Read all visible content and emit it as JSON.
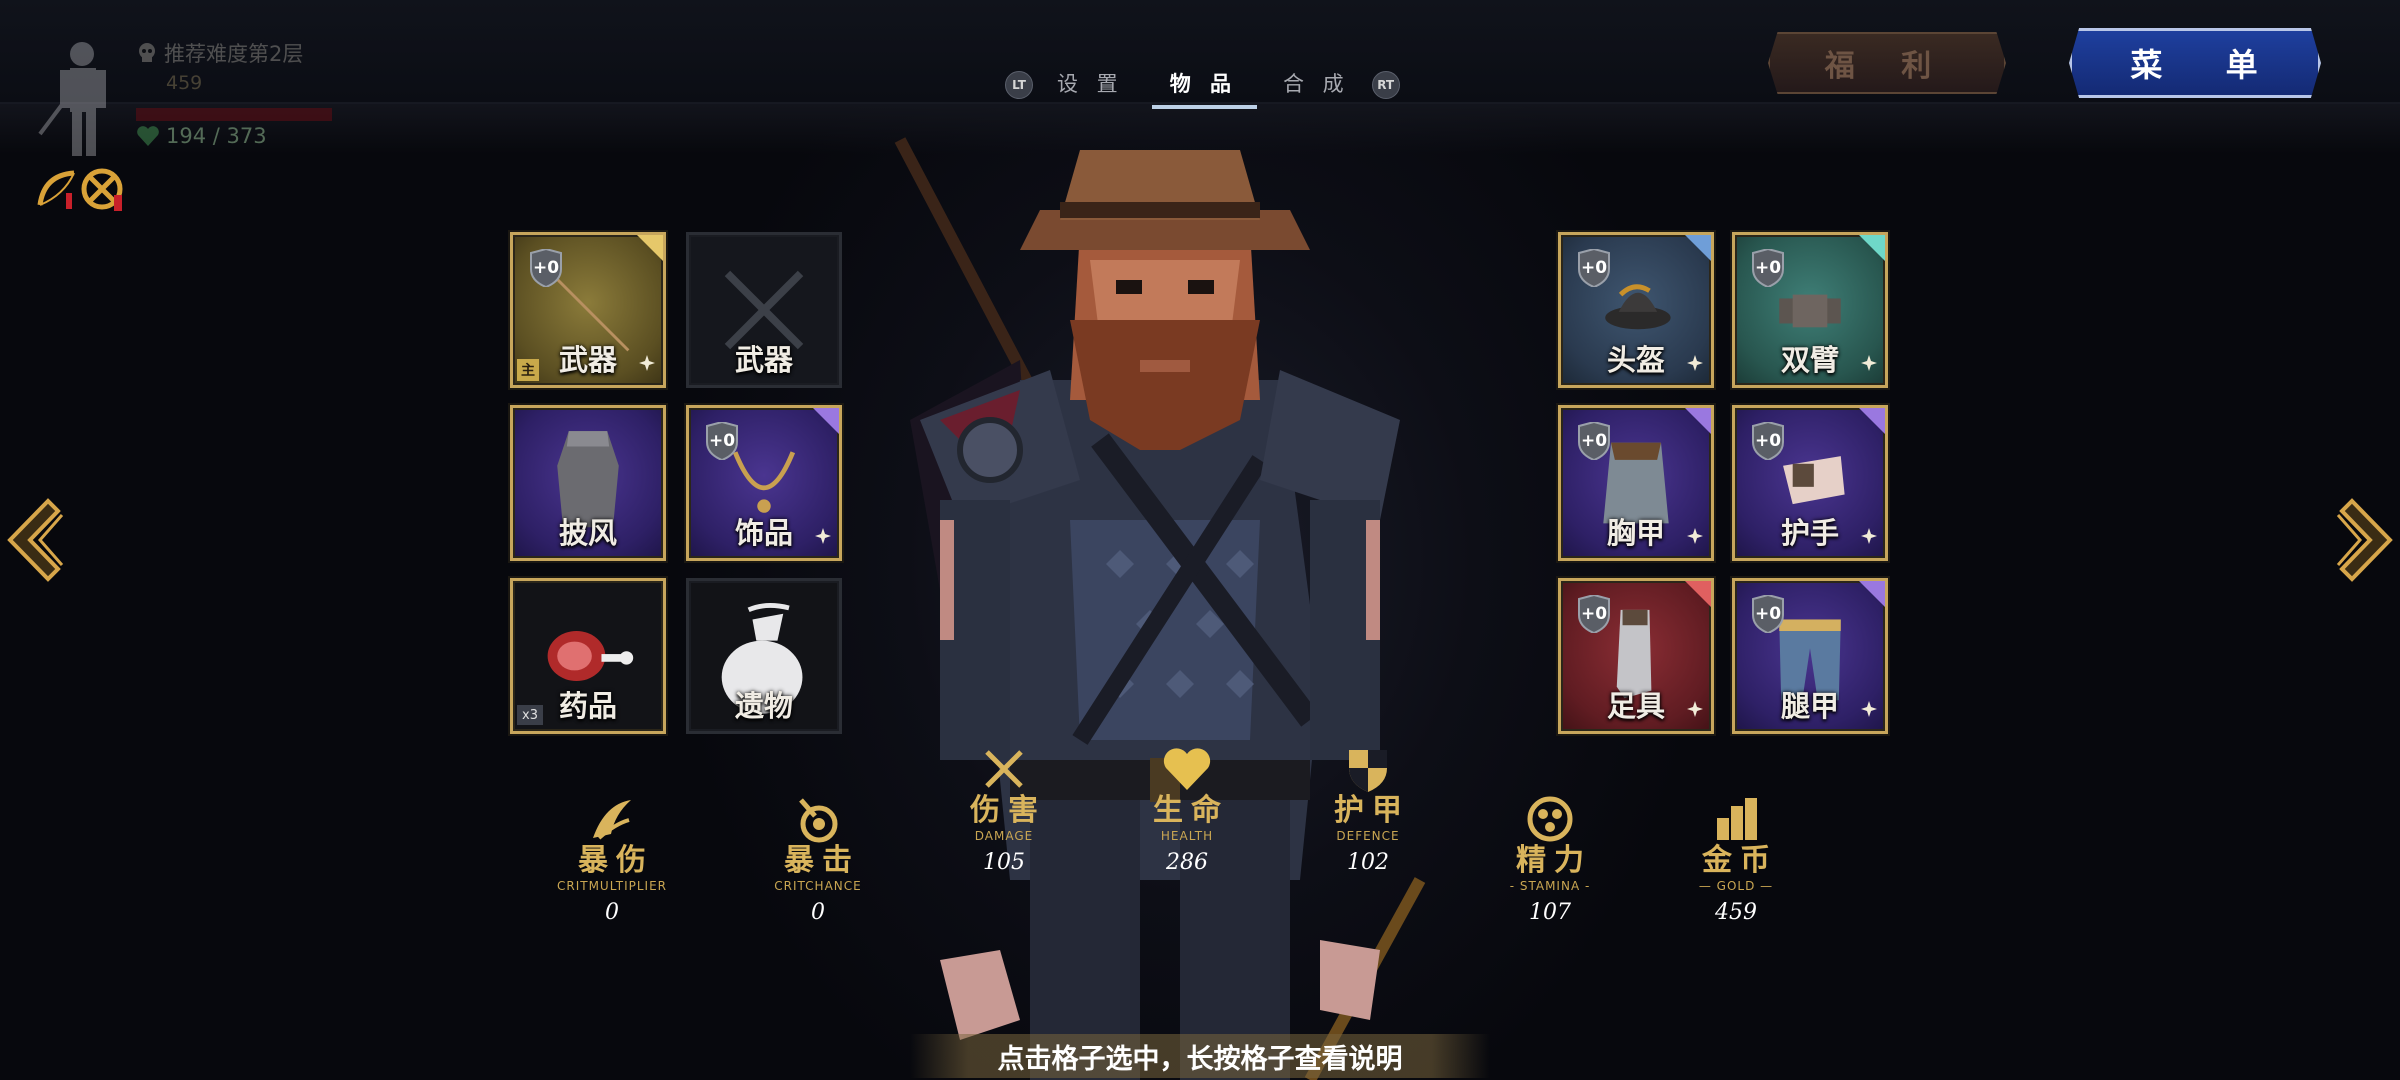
{
  "player": {
    "difficulty": "推荐难度第2层",
    "gold_small": "459",
    "hp": "194 / 373"
  },
  "tabs": {
    "left_trigger": "LT",
    "right_trigger": "RT",
    "items": [
      {
        "label": "设 置",
        "active": false
      },
      {
        "label": "物 品",
        "active": true
      },
      {
        "label": "合 成",
        "active": false
      }
    ]
  },
  "buttons": {
    "welfare": "福 利",
    "menu": "菜 单"
  },
  "equipment_left": [
    {
      "label": "武器",
      "level": "+0",
      "badge": "主"
    },
    {
      "label": "武器"
    },
    {
      "label": "披风"
    },
    {
      "label": "饰品",
      "level": "+0"
    },
    {
      "label": "药品",
      "qty": "x3"
    },
    {
      "label": "遗物"
    }
  ],
  "equipment_right": [
    {
      "label": "头盔",
      "level": "+0"
    },
    {
      "label": "双臂",
      "level": "+0"
    },
    {
      "label": "胸甲",
      "level": "+0"
    },
    {
      "label": "护手",
      "level": "+0"
    },
    {
      "label": "足具",
      "level": "+0"
    },
    {
      "label": "腿甲",
      "level": "+0"
    }
  ],
  "stats": [
    {
      "name": "暴伤",
      "en": "CRITMULTIPLIER",
      "value": "0"
    },
    {
      "name": "暴击",
      "en": "CRITCHANCE",
      "value": "0"
    },
    {
      "name": "伤害",
      "en": "DAMAGE",
      "value": "105"
    },
    {
      "name": "生命",
      "en": "HEALTH",
      "value": "286"
    },
    {
      "name": "护甲",
      "en": "DEFENCE",
      "value": "102"
    },
    {
      "name": "精力",
      "en": "- STAMINA -",
      "value": "107"
    },
    {
      "name": "金币",
      "en": "— GOLD —",
      "value": "459"
    }
  ],
  "hint": "点击格子选中，长按格子查看说明",
  "colors": {
    "gold_accent": "#d9b45c",
    "menu_blue": "#1e3f9e",
    "slot_border": "#c7a65c"
  }
}
